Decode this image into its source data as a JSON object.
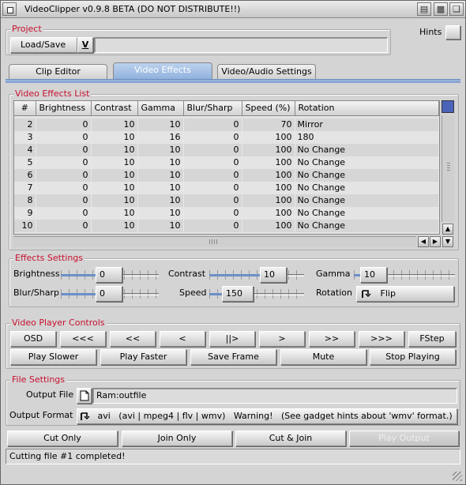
{
  "window": {
    "title": "VideoClipper v0.9.8 BETA (DO NOT DISTRIBUTE!!)"
  },
  "project": {
    "label": "Project",
    "load_save": "Load/Save",
    "dropdown_glyph": "V",
    "name_value": "",
    "hints_label": "Hints"
  },
  "tabs": [
    {
      "label": "Clip Editor"
    },
    {
      "label": "Video Effects"
    },
    {
      "label": "Video/Audio Settings"
    }
  ],
  "effects_list": {
    "label": "Video Effects List",
    "columns": [
      "#",
      "Brightness",
      "Contrast",
      "Gamma",
      "Blur/Sharp",
      "Speed (%)",
      "Rotation"
    ],
    "rows": [
      [
        "2",
        "0",
        "10",
        "10",
        "0",
        "70",
        "Mirror"
      ],
      [
        "3",
        "0",
        "10",
        "16",
        "0",
        "100",
        "180"
      ],
      [
        "4",
        "0",
        "10",
        "10",
        "0",
        "100",
        "No Change"
      ],
      [
        "5",
        "0",
        "10",
        "10",
        "0",
        "100",
        "No Change"
      ],
      [
        "6",
        "0",
        "10",
        "10",
        "0",
        "100",
        "No Change"
      ],
      [
        "7",
        "0",
        "10",
        "10",
        "0",
        "100",
        "No Change"
      ],
      [
        "8",
        "0",
        "10",
        "10",
        "0",
        "100",
        "No Change"
      ],
      [
        "9",
        "0",
        "10",
        "10",
        "0",
        "100",
        "No Change"
      ],
      [
        "10",
        "0",
        "10",
        "10",
        "0",
        "100",
        "No Change"
      ]
    ]
  },
  "effects_settings": {
    "label": "Effects Settings",
    "brightness": {
      "label": "Brightness",
      "value": "0",
      "level": 0.0
    },
    "contrast": {
      "label": "Contrast",
      "value": "10",
      "level": 0.5
    },
    "gamma": {
      "label": "Gamma",
      "value": "10",
      "level": 0.0
    },
    "blur": {
      "label": "Blur/Sharp",
      "value": "0",
      "level": 0.0
    },
    "speed": {
      "label": "Speed",
      "value": "150",
      "level": 0.2
    },
    "rotation": {
      "label": "Rotation",
      "value": "Flip"
    }
  },
  "player": {
    "label": "Video Player Controls",
    "row1": [
      "OSD",
      "<<<",
      "<<",
      "<",
      "||>",
      ">",
      ">>",
      ">>>",
      "FStep"
    ],
    "row2": [
      "Play Slower",
      "Play Faster",
      "Save Frame",
      "Mute",
      "Stop Playing"
    ]
  },
  "file_settings": {
    "label": "File Settings",
    "output_file_label": "Output File",
    "output_file_value": "Ram:outfile",
    "output_format_label": "Output Format",
    "output_format_value": "avi   (avi | mpeg4 | flv | wmv)   Warning!   (See gadget hints about 'wmv' format.)"
  },
  "actions": {
    "cut_only": "Cut Only",
    "join_only": "Join Only",
    "cut_join": "Cut & Join",
    "play_output": "Play Output"
  },
  "status": {
    "text": "Cutting file #1 completed!"
  },
  "colors": {
    "group_label": "#c8102e",
    "active_tab": "#8fb0dc",
    "slider_fill": "#6d8fc7"
  }
}
